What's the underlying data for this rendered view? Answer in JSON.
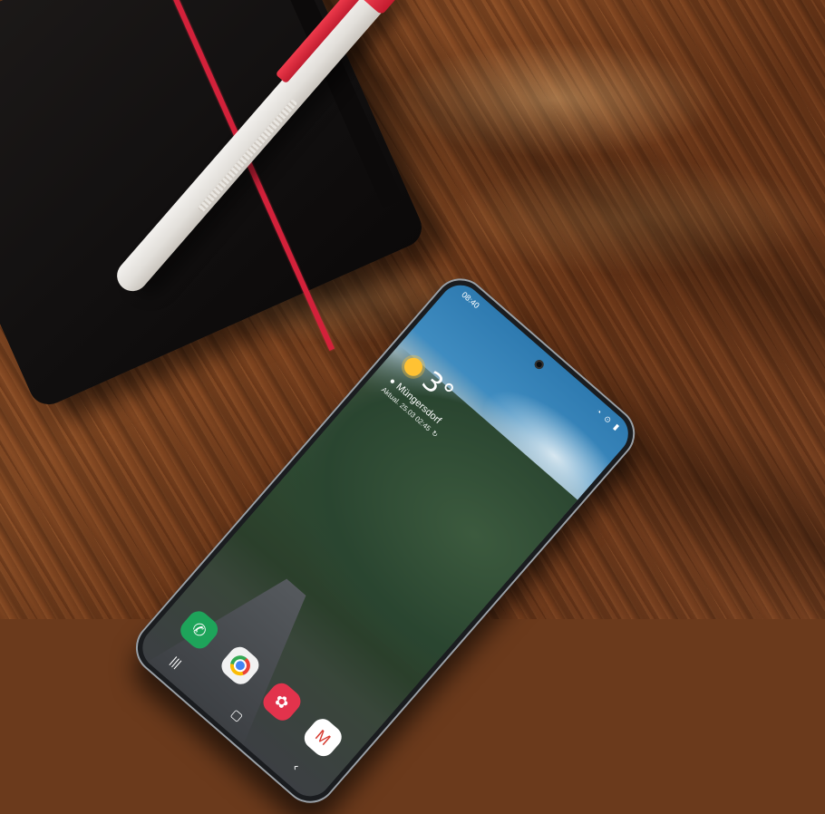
{
  "phone": {
    "status_bar": {
      "time": "08:40",
      "icons": "◔ ⊙ ▮"
    },
    "weather": {
      "temperature": "3°",
      "location": "Müngersdorf",
      "updated": "Aktual. 25.03 02:45",
      "refresh_glyph": "↻"
    },
    "dock": {
      "apps": [
        {
          "name": "phone",
          "glyph": "✆"
        },
        {
          "name": "chrome",
          "glyph": ""
        },
        {
          "name": "galaxy-store",
          "glyph": "✿"
        },
        {
          "name": "gmail",
          "glyph": "M"
        }
      ]
    },
    "navbar": {
      "recents": "|||",
      "home": "▢",
      "back": "‹"
    }
  },
  "colors": {
    "desk": "#7a4120",
    "notebook": "#121010",
    "strap": "#d3213a",
    "pen_body": "#efede9",
    "pen_clip": "#e8303f",
    "phone_frame": "#1a1c1f"
  }
}
